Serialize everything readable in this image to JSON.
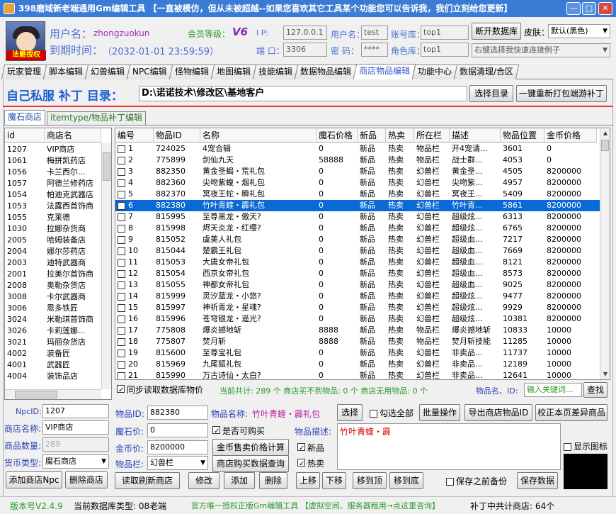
{
  "window": {
    "title": "398磨域新老端通用Gm编辑工具 【一直被模仿，但从未被超越--如果您喜欢其它工具某个功能您可以告诉我，我们立刻给您更新】",
    "min": "—",
    "max": "□",
    "close": "✕"
  },
  "header": {
    "avatar_caption": "法爵授权",
    "username_label": "用户名：",
    "username": "zhongzuokun",
    "expire_label": "到期时间：",
    "expire": "（2032-01-01 23:59:59）",
    "level_label": "会员等级：",
    "level": "V6",
    "ip_label": "I  P:",
    "ip": "127.0.0.1",
    "port_label": "端 口：",
    "port": "3306",
    "user_label": "用户名：",
    "user": "test",
    "pwd_label": "密  码：",
    "pwd": "****",
    "acctdb_label": "账号库：",
    "acctdb": "top1",
    "roledb_label": "角色库：",
    "roledb": "top1",
    "disconnect_button": "断开数据库",
    "skin_label": "皮肤：",
    "skin": "默认(黑色)",
    "quick_connect": "右键选择我快速连接例子"
  },
  "tabs": [
    "玩家管理",
    "脚本编辑",
    "幻兽编辑",
    "NPC编辑",
    "怪物编辑",
    "地图编辑",
    "技能编辑",
    "数据物品编辑",
    "商店物品编辑",
    "功能中心",
    "数据清理/合区"
  ],
  "active_tab": 8,
  "dir_bar": {
    "label": "自己私服 补丁 目录：",
    "path": "D:\\诺诺技术\\修改区\\基地客户",
    "select_button": "选择目录",
    "repack_button": "一键重新打包端游补丁"
  },
  "subtabs": [
    "魔石商店",
    "itemtype/物品补丁编辑"
  ],
  "shop_list": {
    "headers": [
      "id",
      "商店名"
    ],
    "rows": [
      [
        "1207",
        "VIP商店"
      ],
      [
        "1061",
        "梅拼凯药店"
      ],
      [
        "1056",
        "卡兰西尔..."
      ],
      [
        "1057",
        "阿德兰修药店"
      ],
      [
        "1054",
        "帕迪克武器店"
      ],
      [
        "1053",
        "法露西首饰商"
      ],
      [
        "1055",
        "克莱德"
      ],
      [
        "1030",
        "拉娜杂货商"
      ],
      [
        "2005",
        "哈姆装备店"
      ],
      [
        "2004",
        "娜尔莎药店"
      ],
      [
        "2003",
        "迪特武器商"
      ],
      [
        "2001",
        "拉美尔首饰商"
      ],
      [
        "2008",
        "奥勒杂货店"
      ],
      [
        "3008",
        "卡尔武器商"
      ],
      [
        "3006",
        "恩多铁匠"
      ],
      [
        "3024",
        "米勒琪首饰商"
      ],
      [
        "3026",
        "卡莉莲娜..."
      ],
      [
        "3021",
        "玛丽杂货店"
      ],
      [
        "4002",
        "装备匠"
      ],
      [
        "4001",
        "武器匠"
      ],
      [
        "4004",
        "装饰品店"
      ]
    ]
  },
  "items": {
    "headers": [
      "编号",
      "物品ID",
      "名称",
      "魔石价格",
      "新品",
      "热卖",
      "所在栏",
      "描述",
      "物品位置",
      "金币价格"
    ],
    "rows": [
      [
        "1",
        "724025",
        "4宠合辑",
        "0",
        "新品",
        "热卖",
        "物品栏",
        "开4宠请...",
        "3601",
        "0"
      ],
      [
        "2",
        "775899",
        "剑仙九天",
        "58888",
        "新品",
        "热卖",
        "物品栏",
        "战士群...",
        "4053",
        "0"
      ],
      [
        "3",
        "882350",
        "黄金圣蝎・荒礼包",
        "0",
        "新品",
        "热卖",
        "幻兽栏",
        "黄金圣...",
        "4505",
        "8200000"
      ],
      [
        "4",
        "882360",
        "尖吻紫蝮・烟礼包",
        "0",
        "新品",
        "热卖",
        "幻兽栏",
        "尖吻紫...",
        "4957",
        "8200000"
      ],
      [
        "5",
        "882370",
        "冥夜王蛇・瞬礼包",
        "0",
        "新品",
        "热卖",
        "幻兽栏",
        "冥夜王...",
        "5409",
        "8200000"
      ],
      [
        "6",
        "882380",
        "竹叶青蝰・霹礼包",
        "0",
        "新品",
        "热卖",
        "幻兽栏",
        "竹叶青...",
        "5861",
        "8200000"
      ],
      [
        "7",
        "815995",
        "至尊黑龙・傲天?",
        "0",
        "新品",
        "热卖",
        "幻兽栏",
        "超级炫...",
        "6313",
        "8200000"
      ],
      [
        "8",
        "815998",
        "烬天炎龙・红缨?",
        "0",
        "新品",
        "热卖",
        "幻兽栏",
        "超级炫...",
        "6765",
        "8200000"
      ],
      [
        "9",
        "815052",
        "虞美人礼包",
        "0",
        "新品",
        "热卖",
        "幻兽栏",
        "超级血...",
        "7217",
        "8200000"
      ],
      [
        "10",
        "815044",
        "楚霸王礼包",
        "0",
        "新品",
        "热卖",
        "幻兽栏",
        "超级血...",
        "7669",
        "8200000"
      ],
      [
        "11",
        "815053",
        "大唐女帝礼包",
        "0",
        "新品",
        "热卖",
        "幻兽栏",
        "超级血...",
        "8121",
        "8200000"
      ],
      [
        "12",
        "815054",
        "西京女帝礼包",
        "0",
        "新品",
        "热卖",
        "幻兽栏",
        "超级血...",
        "8573",
        "8200000"
      ],
      [
        "13",
        "815055",
        "神都女帝礼包",
        "0",
        "新品",
        "热卖",
        "幻兽栏",
        "超级血...",
        "9025",
        "8200000"
      ],
      [
        "14",
        "815999",
        "灵汐蓝龙・小悠?",
        "0",
        "新品",
        "热卖",
        "幻兽栏",
        "超级炫...",
        "9477",
        "8200000"
      ],
      [
        "15",
        "815997",
        "神祈青龙・星魂?",
        "0",
        "新品",
        "热卖",
        "幻兽栏",
        "超级炫...",
        "9929",
        "8200000"
      ],
      [
        "16",
        "815996",
        "苍穹银龙・遥光?",
        "0",
        "新品",
        "热卖",
        "幻兽栏",
        "超级炫...",
        "10381",
        "8200000"
      ],
      [
        "17",
        "775808",
        "爆炎撼地斩",
        "8888",
        "新品",
        "热卖",
        "物品栏",
        "爆炎撼地斩",
        "10833",
        "10000"
      ],
      [
        "18",
        "775807",
        "焚月斩",
        "8888",
        "新品",
        "热卖",
        "物品栏",
        "焚月斩技能",
        "11285",
        "10000"
      ],
      [
        "19",
        "815600",
        "至尊宝礼包",
        "0",
        "新品",
        "热卖",
        "幻兽栏",
        "非卖品...",
        "11737",
        "10000"
      ],
      [
        "20",
        "815969",
        "九尾狐礼包",
        "0",
        "新品",
        "热卖",
        "幻兽栏",
        "非卖品...",
        "12189",
        "10000"
      ],
      [
        "21",
        "815990",
        "万古诗仙・太白?",
        "0",
        "新品",
        "热卖",
        "幻兽栏",
        "非卖品...",
        "12641",
        "10000"
      ]
    ],
    "selected": 5
  },
  "summary": {
    "sync_label": "同步读取数据库物价",
    "total": "当前共计: 289 个 商店买不到物品: 0 个 商店无用物品: 0 个",
    "search_label": "物品名、ID:",
    "search_placeholder": "输入关键词...",
    "search_button": "查找"
  },
  "shop_form": {
    "npcid_label": "NpcID:",
    "npcid": "1207",
    "name_label": "商店名称:",
    "name": "VIP商店",
    "count_label": "商品数量:",
    "count": "289",
    "currency_label": "货币类型:",
    "currency": "魔石商店",
    "add_button": "添加商店Npc",
    "del_button": "删除商店"
  },
  "item_form": {
    "id_label": "物品ID:",
    "id": "882380",
    "name_label": "物品名称:",
    "name": "竹叶青蝰・霹礼包",
    "select_button": "选择",
    "select_all": "勾选全部",
    "batch_button": "批量操作",
    "export_button": "导出商店物品ID",
    "fix_button": "校正本页差异商品",
    "stone_label": "魔石价:",
    "stone": "0",
    "buyable": "是否可购买",
    "desc_label": "物品描述:",
    "desc": "竹叶青蝰・霹",
    "gold_label": "金币价:",
    "gold": "8200000",
    "calc_button": "金币售卖价格计算",
    "new_label": "新品",
    "bar_label": "物品栏:",
    "bar": "幻兽栏",
    "query_button": "商店购买数据查询",
    "hot_label": "热卖",
    "show_icon": "显示图标",
    "refresh_button": "读取刷新商店",
    "edit_button": "修改",
    "add_button": "添加",
    "delete_button": "删除",
    "up_button": "上移",
    "down_button": "下移",
    "top_button": "移到顶",
    "bottom_button": "移到底",
    "backup_label": "保存之前备份",
    "save_button": "保存数据"
  },
  "statusbar": {
    "version": "版本号V2.4.9",
    "dbtype": "当前数据库类型: 08老端",
    "official": "官方唯一授权正版Gm编辑工具 【虚拟空间、服务器租用→点这里咨询】",
    "patch": "补丁中共计商店: 64个"
  },
  "colors": {
    "title": "#3a7bd5",
    "accent": "#4a6ed8",
    "purple": "#9b2fb8",
    "selection": "#0a6ad5",
    "green": "#2a9a2a"
  }
}
